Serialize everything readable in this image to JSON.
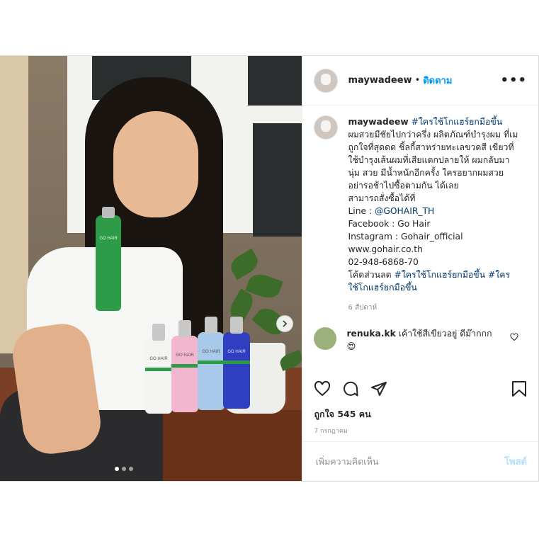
{
  "header": {
    "username": "maywadeew",
    "separator": "•",
    "follow_label": "ติดตาม",
    "more_label": "•••"
  },
  "caption": {
    "username": "maywadeew",
    "hashtag": "#ใครใช้โกแฮร์ยกมือขึ้น",
    "body": "ผมสวยมีชัยไปกว่าครึ่ง ผลิตภัณฑ์บำรุงผม ที่เมถูกใจที่สุดดด ชิ้ลกี้สาหร่ายทะเลขวดสี เขียวที่ใช้บำรุงเส้นผมที่เสียแตกปลายให้ ผมกลับมานุ่ม สวย มีน้ำหนักอีกครั้ง ใครอยากผมสวย อย่ารอช้าไปซื้อตามกัน ได้เลย",
    "order_line": "สามารถสั่งซื้อได้ที่",
    "line_label": "Line : ",
    "line_value": "@GOHAIR_TH",
    "facebook": "Facebook : Go Hair",
    "instagram": "Instagram : Gohair_official",
    "website": "www.gohair.co.th",
    "phone": "02-948-6868-70",
    "discount_label": "โค้ดส่วนลด ",
    "discount_tags": "#ใครใช้โกแฮร์ยกมือขึ้น #ใคร ใช้โกแฮร์ยกมือขึ้น",
    "time": "6 สัปดาห์"
  },
  "comment": {
    "username": "renuka.kk",
    "text": "เค้าใช้สีเขียวอยู่ ดีม๊ากกก",
    "emoji": "😍"
  },
  "likes": "ถูกใจ 545 คน",
  "date": "7 กรกฎาคม",
  "add_comment": {
    "placeholder": "เพิ่มความคิดเห็น",
    "post_label": "โพสต์"
  },
  "product": {
    "brand": "GO HAIR"
  },
  "colors": {
    "link_blue": "#0095f6",
    "hashtag": "#00376b",
    "post_disabled": "#b2dffc",
    "bottle_green": "#2e9b48",
    "bottle_white": "#f4f4f2",
    "bottle_pink": "#f2b6cf",
    "bottle_lightblue": "#a9c9ea",
    "bottle_blue": "#2f3fbf"
  },
  "carousel": {
    "total_slides": 3,
    "active_slide": 1
  }
}
